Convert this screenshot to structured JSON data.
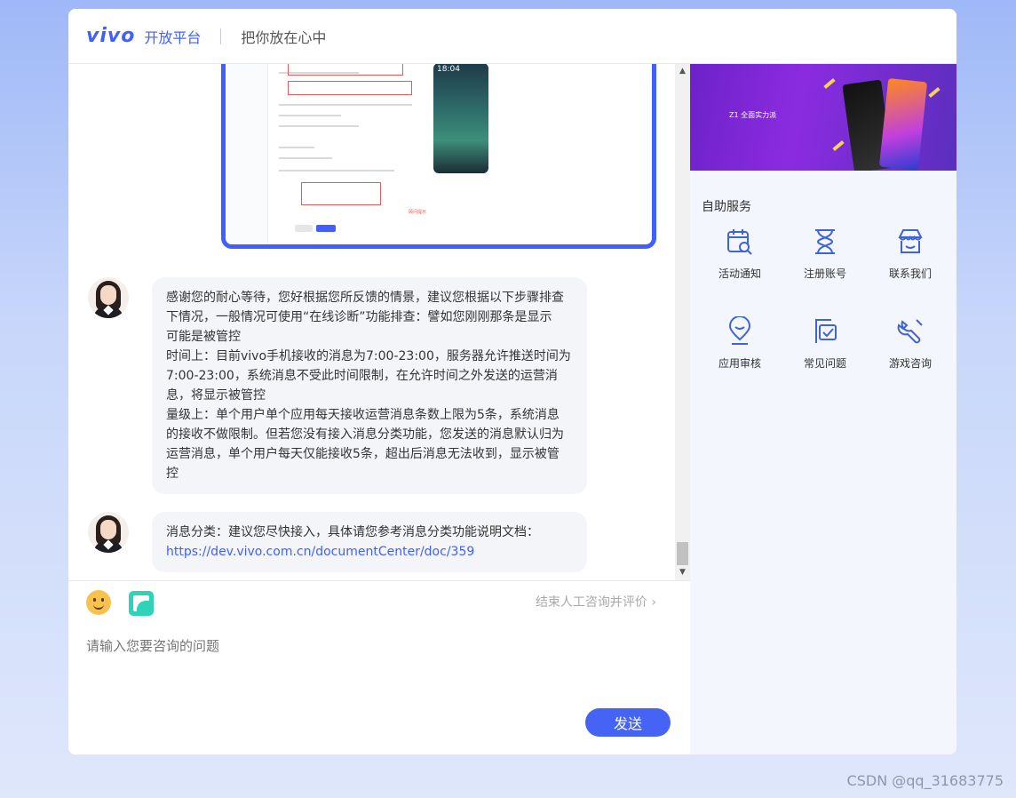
{
  "header": {
    "logo": "vivo",
    "platform": "开放平台",
    "slogan": "把你放在心中"
  },
  "shot": {
    "phone_time": "18:04",
    "red_note": "顾问提示"
  },
  "messages": [
    {
      "lines": [
        "感谢您的耐心等待，您好根据您所反馈的情景，建议您根据以下步骤排查",
        "下情况，一般情况可使用“在线诊断”功能排查：譬如您刚刚那条是显示",
        "可能是被管控",
        "时间上：目前vivo手机接收的消息为7:00-23:00，服务器允许推送时间为",
        "7:00-23:00，系统消息不受此时间限制，在允许时间之外发送的运营消",
        "息，将显示被管控",
        "量级上：单个用户单个应用每天接收运营消息条数上限为5条，系统消息",
        "的接收不做限制。但若您没有接入消息分类功能，您发送的消息默认归为",
        "运营消息，单个用户每天仅能接收5条，超出后消息无法收到，显示被管",
        "控"
      ]
    },
    {
      "text": "消息分类：建议您尽快接入，具体请您参考消息分类功能说明文档：",
      "link": "https://dev.vivo.com.cn/documentCenter/doc/359"
    }
  ],
  "toolbar": {
    "end_link": "结束人工咨询并评价",
    "input_placeholder": "请输入您要咨询的问题",
    "send_label": "发送"
  },
  "banner": {
    "line1": "Z1 全面实力派"
  },
  "services": {
    "title": "自助服务",
    "items": [
      {
        "label": "活动通知",
        "icon": "calendar-search-icon"
      },
      {
        "label": "注册账号",
        "icon": "hourglass-icon"
      },
      {
        "label": "联系我们",
        "icon": "store-icon"
      },
      {
        "label": "应用审核",
        "icon": "location-pin-icon"
      },
      {
        "label": "常见问题",
        "icon": "document-check-icon"
      },
      {
        "label": "游戏咨询",
        "icon": "wrench-icon"
      }
    ]
  },
  "colors": {
    "accent": "#415fff",
    "send_button": "#4564f6",
    "bubble": "#f3f5f8"
  },
  "watermark": "CSDN @qq_31683775"
}
